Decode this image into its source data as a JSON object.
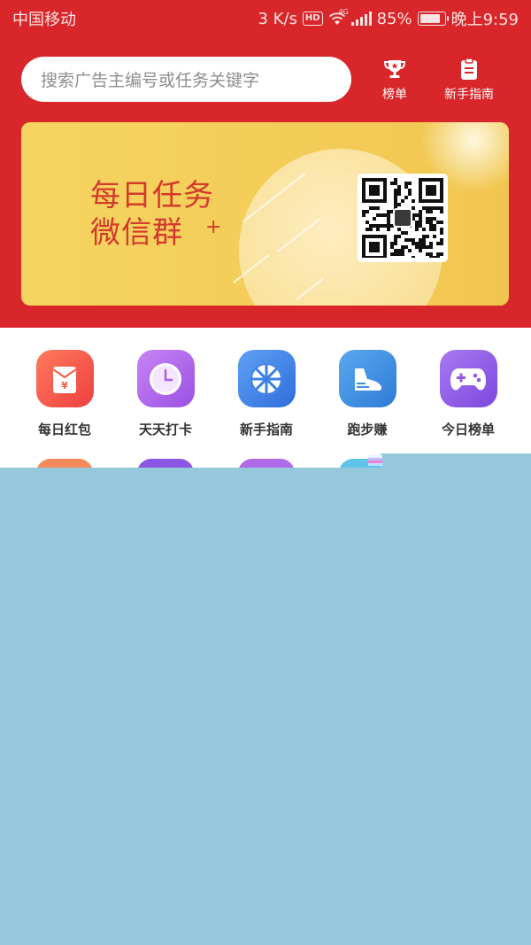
{
  "status_bar": {
    "carrier": "中国移动",
    "speed": "3 K/s",
    "hd": "HD",
    "network": "4G",
    "battery": "85%",
    "time": "晚上9:59",
    "battery_level": 0.85
  },
  "search": {
    "placeholder": "搜索广告主编号或任务关键字"
  },
  "header_buttons": [
    {
      "label": "榜单",
      "icon": "trophy-icon"
    },
    {
      "label": "新手指南",
      "icon": "clipboard-icon"
    }
  ],
  "banner": {
    "line1": "每日任务",
    "line2": "微信群",
    "plus": "+",
    "qr": "qr-code-icon"
  },
  "menu": [
    {
      "label": "每日红包",
      "icon": "red-envelope-icon",
      "color": "#f2554c"
    },
    {
      "label": "天天打卡",
      "icon": "clock-icon",
      "color": "#b36ae8"
    },
    {
      "label": "新手指南",
      "icon": "wheel-icon",
      "color": "#3c7fe6"
    },
    {
      "label": "跑步赚",
      "icon": "shoe-icon",
      "color": "#3f8fe0"
    },
    {
      "label": "今日榜单",
      "icon": "gamepad-icon",
      "color": "#9457e6"
    }
  ],
  "colors": {
    "header": "#d8262a",
    "banner": "#f3cc56",
    "banner_text": "#d33a2c",
    "overlay": "#95c8da"
  }
}
